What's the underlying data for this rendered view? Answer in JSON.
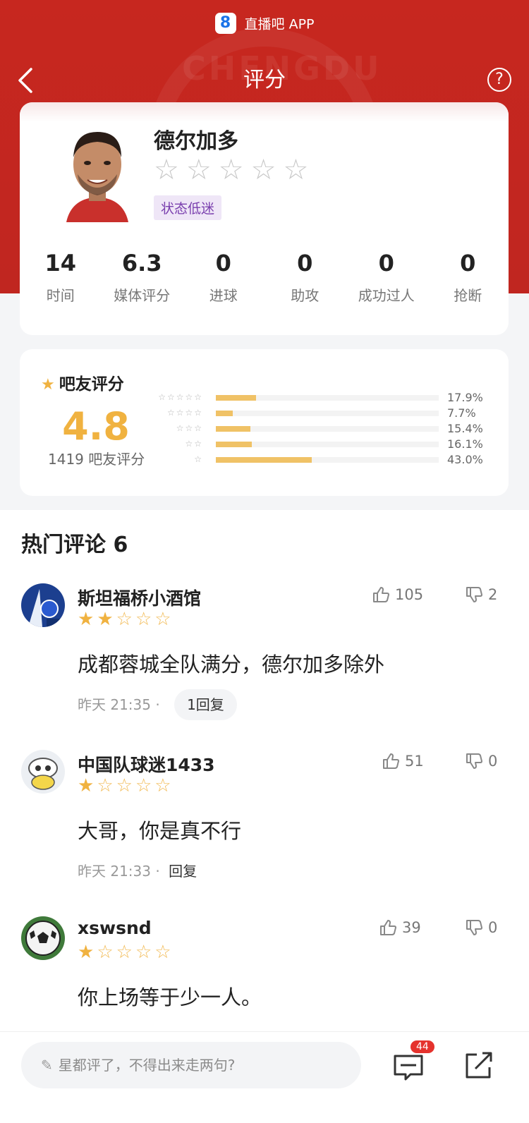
{
  "header": {
    "brand_badge": "8",
    "brand_text": "直播吧 APP",
    "title": "评分",
    "help": "?",
    "watermark": "CHENGDU"
  },
  "player": {
    "name": "德尔加多",
    "stars": [
      "☆",
      "☆",
      "☆",
      "☆",
      "☆"
    ],
    "status": "状态低迷",
    "stats": [
      {
        "value": "14",
        "label": "时间"
      },
      {
        "value": "6.3",
        "label": "媒体评分"
      },
      {
        "value": "0",
        "label": "进球"
      },
      {
        "value": "0",
        "label": "助攻"
      },
      {
        "value": "0",
        "label": "成功过人"
      },
      {
        "value": "0",
        "label": "抢断"
      }
    ]
  },
  "fan_rating": {
    "title": "吧友评分",
    "score": "4.8",
    "count": "1419 吧友评分",
    "rows": [
      {
        "stars": "☆☆☆☆☆",
        "fraction": 0.179,
        "pct": "17.9%"
      },
      {
        "stars": "☆☆☆☆",
        "fraction": 0.077,
        "pct": "7.7%"
      },
      {
        "stars": "☆☆☆",
        "fraction": 0.154,
        "pct": "15.4%"
      },
      {
        "stars": "☆☆",
        "fraction": 0.161,
        "pct": "16.1%"
      },
      {
        "stars": "☆",
        "fraction": 0.43,
        "pct": "43.0%"
      }
    ]
  },
  "comments_section": {
    "title": "热门评论 6",
    "items": [
      {
        "name": "斯坦福桥小酒馆",
        "rating": 2,
        "text": "成都蓉城全队满分，德尔加多除外",
        "time": "昨天 21:35",
        "reply": "1回复",
        "likes": "105",
        "dislikes": "2"
      },
      {
        "name": "中国队球迷1433",
        "rating": 1,
        "text": "大哥，你是真不行",
        "time": "昨天 21:33",
        "reply": "回复",
        "likes": "51",
        "dislikes": "0"
      },
      {
        "name": "xswsnd",
        "rating": 1,
        "text": "你上场等于少一人。",
        "time": "",
        "reply": "",
        "likes": "39",
        "dislikes": "0"
      }
    ]
  },
  "bottom": {
    "placeholder": "星都评了，不得出来走两句?",
    "comment_badge": "44"
  },
  "colors": {
    "primary_red": "#c7271f",
    "star_gold": "#f0b240",
    "status_purple": "#7a3fae"
  }
}
